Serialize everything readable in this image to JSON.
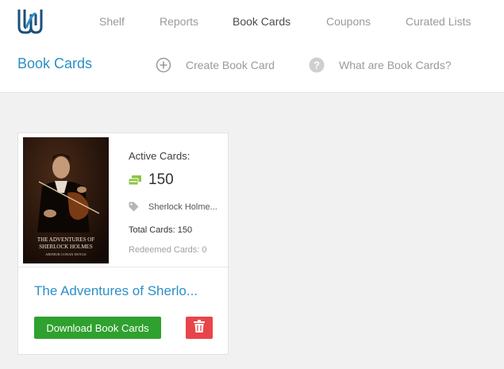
{
  "nav": {
    "items": [
      {
        "label": "Shelf"
      },
      {
        "label": "Reports"
      },
      {
        "label": "Book Cards"
      },
      {
        "label": "Coupons"
      },
      {
        "label": "Curated Lists"
      }
    ],
    "active": "Book Cards"
  },
  "header": {
    "title": "Book Cards",
    "create_label": "Create Book Card",
    "help_label": "What are Book Cards?"
  },
  "card": {
    "cover": {
      "title_line1": "THE ADVENTURES OF",
      "title_line2": "SHERLOCK HOLMES",
      "author": "ARTHUR CONAN DOYLE"
    },
    "active_label": "Active Cards:",
    "active_count": "150",
    "tag": "Sherlock Holme...",
    "total": "Total Cards: 150",
    "redeemed": "Redeemed Cards: 0",
    "title": "The Adventures of Sherlo...",
    "download_label": "Download Book Cards"
  },
  "colors": {
    "accent": "#2b8fc6",
    "download": "#2ea12e",
    "delete": "#e8454a",
    "cards_icon": "#8cc63f"
  },
  "icons": {
    "logo": "logo-icon",
    "create": "plus-circle-icon",
    "help": "question-circle-icon",
    "cards": "cards-icon",
    "tag": "tag-icon",
    "delete": "trash-icon"
  }
}
